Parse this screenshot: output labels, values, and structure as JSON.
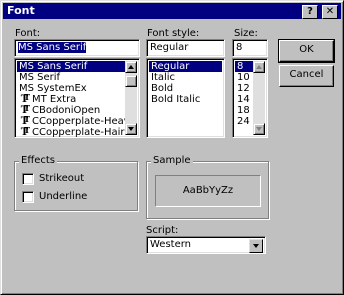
{
  "dialog": {
    "title": "Font"
  },
  "title_buttons": {
    "help": "?",
    "close": "✕"
  },
  "font": {
    "label": "Font:",
    "value": "MS Sans Serif",
    "items": [
      {
        "name": "MS Sans Serif",
        "selected": true,
        "icon": ""
      },
      {
        "name": "MS Serif",
        "selected": false,
        "icon": ""
      },
      {
        "name": "MS SystemEx",
        "selected": false,
        "icon": ""
      },
      {
        "name": "MT Extra",
        "selected": false,
        "icon": "truetype-icon"
      },
      {
        "name": "CBodoniOpen",
        "selected": false,
        "icon": "truetype-icon"
      },
      {
        "name": "CCopperplate-Heavy",
        "selected": false,
        "icon": "truetype-icon"
      },
      {
        "name": "CCopperplate-Hair",
        "selected": false,
        "icon": "truetype-icon"
      }
    ]
  },
  "style": {
    "label": "Font style:",
    "value": "Regular",
    "items": [
      "Regular",
      "Italic",
      "Bold",
      "Bold Italic"
    ]
  },
  "size": {
    "label": "Size:",
    "value": "8",
    "items": [
      "8",
      "10",
      "12",
      "14",
      "18",
      "24"
    ]
  },
  "buttons": {
    "ok": "OK",
    "cancel": "Cancel"
  },
  "effects": {
    "label": "Effects",
    "strikeout": "Strikeout",
    "underline": "Underline"
  },
  "sample": {
    "label": "Sample",
    "text": "AaBbYyZz"
  },
  "script": {
    "label": "Script:",
    "value": "Western"
  },
  "colors": {
    "selection": "#000080",
    "face": "#c0c0c0"
  }
}
